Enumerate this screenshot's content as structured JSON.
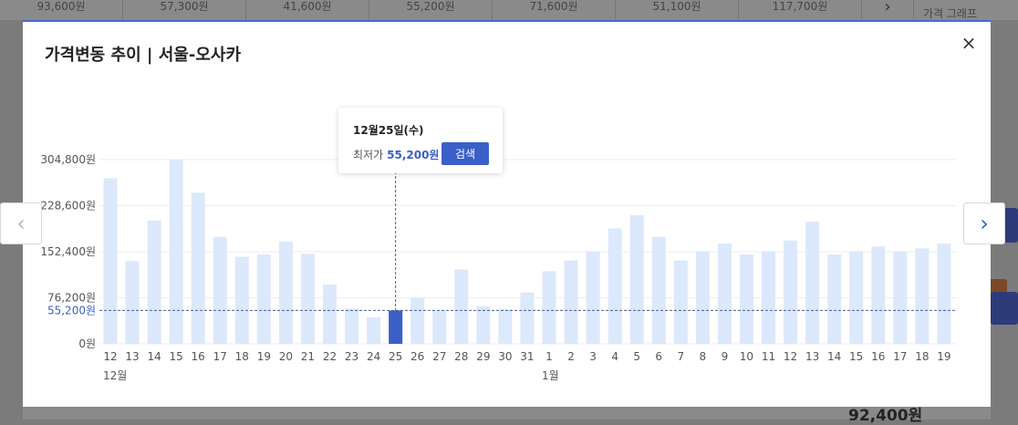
{
  "background": {
    "prices": [
      "93,600원",
      "57,300원",
      "41,600원",
      "55,200원",
      "71,600원",
      "51,100원",
      "117,700원"
    ],
    "graph_link": "가격 그래프",
    "bottom_price": "92,400원"
  },
  "modal": {
    "title": "가격변동 추이 | 서울-오사카",
    "close_icon": "×",
    "prev_icon": "‹",
    "next_icon": "›"
  },
  "tooltip": {
    "date": "12월25일(수)",
    "label": "최저가",
    "value": "55,200원",
    "search_label": "검색"
  },
  "colors": {
    "bar": "#dce8fb",
    "bar_selected": "#3a5fc8",
    "accent": "#3a5fc8"
  },
  "chart_data": {
    "type": "bar",
    "categories": [
      "12",
      "13",
      "14",
      "15",
      "16",
      "17",
      "18",
      "19",
      "20",
      "21",
      "22",
      "23",
      "24",
      "25",
      "26",
      "27",
      "28",
      "29",
      "30",
      "31",
      "1",
      "2",
      "3",
      "4",
      "5",
      "6",
      "7",
      "8",
      "9",
      "10",
      "11",
      "12",
      "13",
      "14",
      "15",
      "16",
      "17",
      "18",
      "19"
    ],
    "values": [
      274000,
      137000,
      204000,
      305000,
      250000,
      177000,
      144000,
      148000,
      169000,
      149000,
      98000,
      58000,
      44000,
      55200,
      76000,
      55000,
      123000,
      62000,
      57000,
      85000,
      120000,
      138000,
      153000,
      191000,
      213000,
      177000,
      138000,
      153000,
      166000,
      148000,
      153000,
      171000,
      202000,
      148000,
      153000,
      161000,
      153000,
      158000,
      166000
    ],
    "month_labels": [
      {
        "index": 0,
        "label": "12월"
      },
      {
        "index": 20,
        "label": "1월"
      }
    ],
    "y_ticks": [
      {
        "value": 0,
        "label": "0원"
      },
      {
        "value": 76200,
        "label": "76,200원"
      },
      {
        "value": 152400,
        "label": "152,400원"
      },
      {
        "value": 228600,
        "label": "228,600원"
      },
      {
        "value": 304800,
        "label": "304,800원"
      }
    ],
    "reference_line": {
      "value": 55200,
      "label": "55,200원"
    },
    "selected_index": 13,
    "ylim": [
      0,
      304800
    ],
    "grid": true
  }
}
